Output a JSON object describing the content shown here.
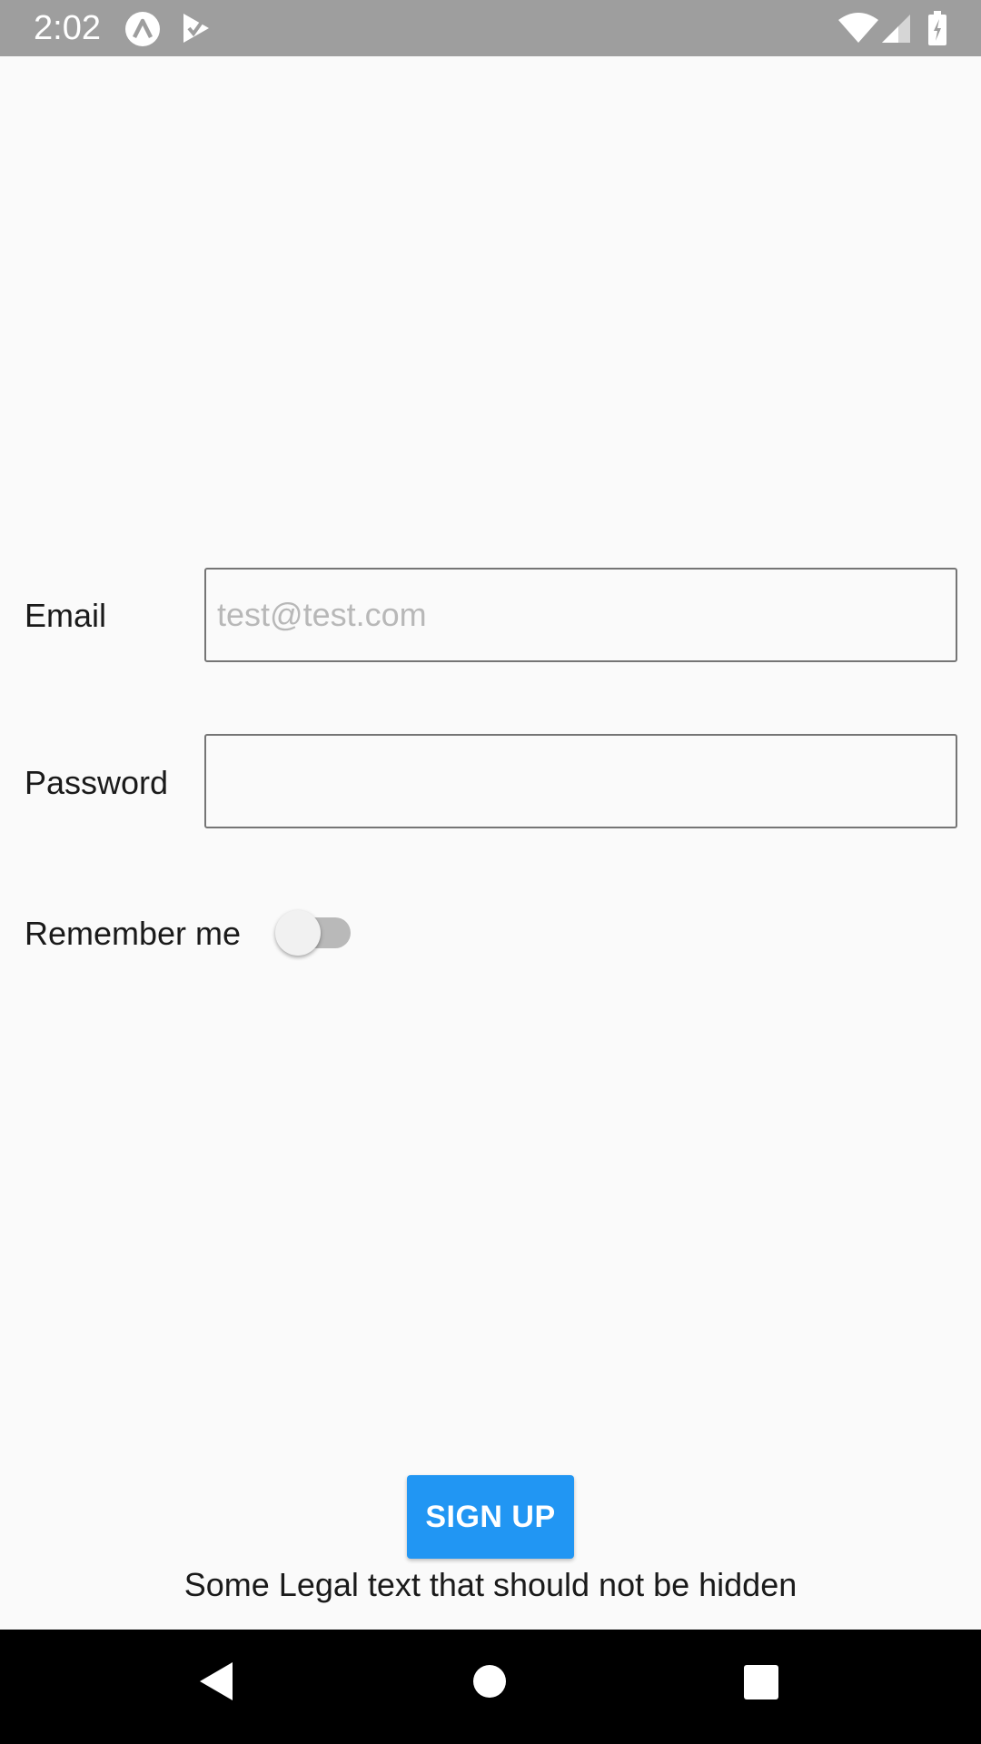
{
  "status_bar": {
    "time": "2:02",
    "icons": [
      "app-notification-icon",
      "play-store-icon",
      "wifi-icon",
      "cell-signal-icon",
      "battery-icon"
    ]
  },
  "form": {
    "email": {
      "label": "Email",
      "placeholder": "test@test.com",
      "value": ""
    },
    "password": {
      "label": "Password",
      "placeholder": "",
      "value": ""
    },
    "remember": {
      "label": "Remember me",
      "on": false
    }
  },
  "signup": {
    "label": "SIGN UP"
  },
  "legal": {
    "text": "Some Legal text that should not be hidden"
  },
  "nav_bar": {
    "icons": [
      "back-icon",
      "home-icon",
      "recents-icon"
    ]
  },
  "colors": {
    "status_bar": "#9e9e9e",
    "background": "#fafafa",
    "accent": "#2196f3",
    "nav_bar": "#000000"
  }
}
